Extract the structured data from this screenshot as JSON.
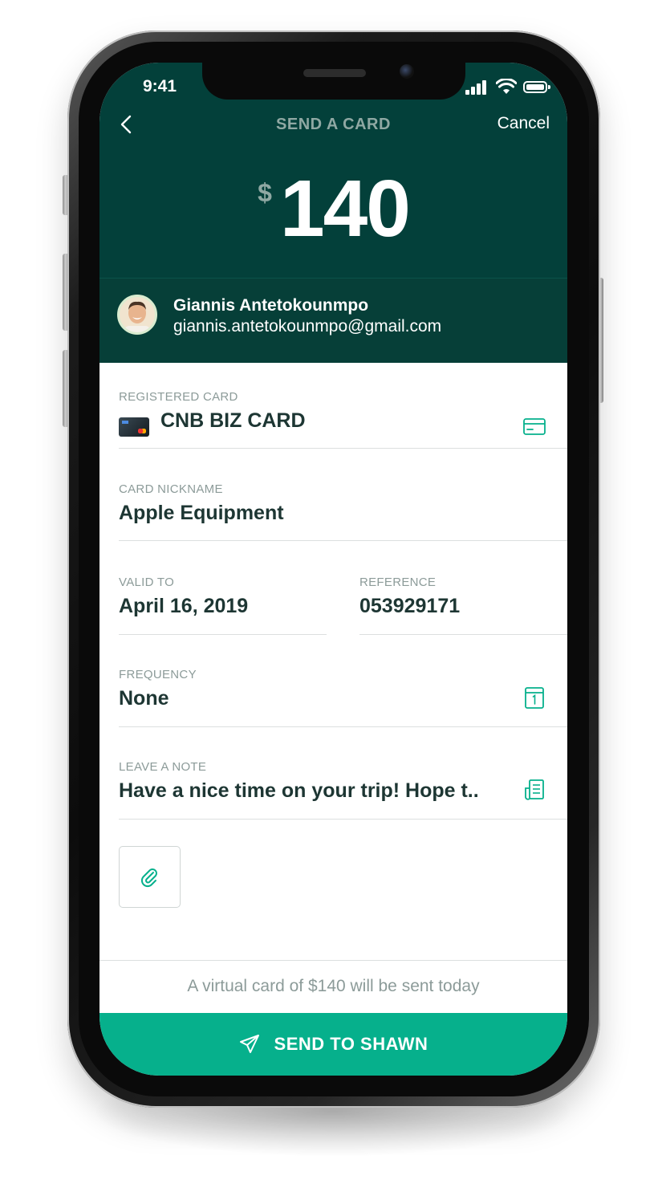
{
  "status_bar": {
    "time": "9:41"
  },
  "nav": {
    "title": "SEND A CARD",
    "cancel_label": "Cancel",
    "back_icon": "chevron-left-icon"
  },
  "amount": {
    "currency": "$",
    "value": "140"
  },
  "recipient": {
    "name": "Giannis Antetokounmpo",
    "email": "giannis.antetokounmpo@gmail.com"
  },
  "form": {
    "registered_card": {
      "label": "REGISTERED CARD",
      "value": "CNB BIZ CARD",
      "icon": "credit-card-icon"
    },
    "card_nickname": {
      "label": "CARD NICKNAME",
      "value": "Apple Equipment"
    },
    "valid_to": {
      "label": "VALID TO",
      "value": "April 16, 2019"
    },
    "reference": {
      "label": "REFERENCE",
      "value": "053929171"
    },
    "frequency": {
      "label": "FREQUENCY",
      "value": "None",
      "icon": "calendar-icon"
    },
    "note": {
      "label": "LEAVE A NOTE",
      "value": "Have a nice time on your trip! Hope t..",
      "icon": "note-icon"
    },
    "attachment_icon": "paperclip-icon"
  },
  "footer": {
    "note": "A virtual card of $140 will be sent today"
  },
  "send_button": {
    "label": "SEND TO SHAWN",
    "icon": "paper-plane-icon"
  },
  "colors": {
    "header": "#03403a",
    "accent": "#06b08c",
    "text_dark": "#1d3633",
    "text_muted": "#8c9b99"
  }
}
